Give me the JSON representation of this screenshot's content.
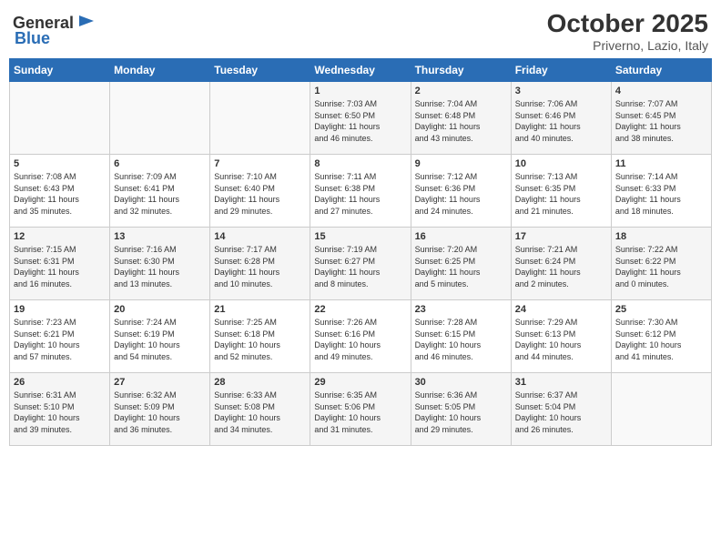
{
  "header": {
    "logo_general": "General",
    "logo_blue": "Blue",
    "month_title": "October 2025",
    "location": "Priverno, Lazio, Italy"
  },
  "weekdays": [
    "Sunday",
    "Monday",
    "Tuesday",
    "Wednesday",
    "Thursday",
    "Friday",
    "Saturday"
  ],
  "weeks": [
    [
      {
        "day": "",
        "info": ""
      },
      {
        "day": "",
        "info": ""
      },
      {
        "day": "",
        "info": ""
      },
      {
        "day": "1",
        "info": "Sunrise: 7:03 AM\nSunset: 6:50 PM\nDaylight: 11 hours\nand 46 minutes."
      },
      {
        "day": "2",
        "info": "Sunrise: 7:04 AM\nSunset: 6:48 PM\nDaylight: 11 hours\nand 43 minutes."
      },
      {
        "day": "3",
        "info": "Sunrise: 7:06 AM\nSunset: 6:46 PM\nDaylight: 11 hours\nand 40 minutes."
      },
      {
        "day": "4",
        "info": "Sunrise: 7:07 AM\nSunset: 6:45 PM\nDaylight: 11 hours\nand 38 minutes."
      }
    ],
    [
      {
        "day": "5",
        "info": "Sunrise: 7:08 AM\nSunset: 6:43 PM\nDaylight: 11 hours\nand 35 minutes."
      },
      {
        "day": "6",
        "info": "Sunrise: 7:09 AM\nSunset: 6:41 PM\nDaylight: 11 hours\nand 32 minutes."
      },
      {
        "day": "7",
        "info": "Sunrise: 7:10 AM\nSunset: 6:40 PM\nDaylight: 11 hours\nand 29 minutes."
      },
      {
        "day": "8",
        "info": "Sunrise: 7:11 AM\nSunset: 6:38 PM\nDaylight: 11 hours\nand 27 minutes."
      },
      {
        "day": "9",
        "info": "Sunrise: 7:12 AM\nSunset: 6:36 PM\nDaylight: 11 hours\nand 24 minutes."
      },
      {
        "day": "10",
        "info": "Sunrise: 7:13 AM\nSunset: 6:35 PM\nDaylight: 11 hours\nand 21 minutes."
      },
      {
        "day": "11",
        "info": "Sunrise: 7:14 AM\nSunset: 6:33 PM\nDaylight: 11 hours\nand 18 minutes."
      }
    ],
    [
      {
        "day": "12",
        "info": "Sunrise: 7:15 AM\nSunset: 6:31 PM\nDaylight: 11 hours\nand 16 minutes."
      },
      {
        "day": "13",
        "info": "Sunrise: 7:16 AM\nSunset: 6:30 PM\nDaylight: 11 hours\nand 13 minutes."
      },
      {
        "day": "14",
        "info": "Sunrise: 7:17 AM\nSunset: 6:28 PM\nDaylight: 11 hours\nand 10 minutes."
      },
      {
        "day": "15",
        "info": "Sunrise: 7:19 AM\nSunset: 6:27 PM\nDaylight: 11 hours\nand 8 minutes."
      },
      {
        "day": "16",
        "info": "Sunrise: 7:20 AM\nSunset: 6:25 PM\nDaylight: 11 hours\nand 5 minutes."
      },
      {
        "day": "17",
        "info": "Sunrise: 7:21 AM\nSunset: 6:24 PM\nDaylight: 11 hours\nand 2 minutes."
      },
      {
        "day": "18",
        "info": "Sunrise: 7:22 AM\nSunset: 6:22 PM\nDaylight: 11 hours\nand 0 minutes."
      }
    ],
    [
      {
        "day": "19",
        "info": "Sunrise: 7:23 AM\nSunset: 6:21 PM\nDaylight: 10 hours\nand 57 minutes."
      },
      {
        "day": "20",
        "info": "Sunrise: 7:24 AM\nSunset: 6:19 PM\nDaylight: 10 hours\nand 54 minutes."
      },
      {
        "day": "21",
        "info": "Sunrise: 7:25 AM\nSunset: 6:18 PM\nDaylight: 10 hours\nand 52 minutes."
      },
      {
        "day": "22",
        "info": "Sunrise: 7:26 AM\nSunset: 6:16 PM\nDaylight: 10 hours\nand 49 minutes."
      },
      {
        "day": "23",
        "info": "Sunrise: 7:28 AM\nSunset: 6:15 PM\nDaylight: 10 hours\nand 46 minutes."
      },
      {
        "day": "24",
        "info": "Sunrise: 7:29 AM\nSunset: 6:13 PM\nDaylight: 10 hours\nand 44 minutes."
      },
      {
        "day": "25",
        "info": "Sunrise: 7:30 AM\nSunset: 6:12 PM\nDaylight: 10 hours\nand 41 minutes."
      }
    ],
    [
      {
        "day": "26",
        "info": "Sunrise: 6:31 AM\nSunset: 5:10 PM\nDaylight: 10 hours\nand 39 minutes."
      },
      {
        "day": "27",
        "info": "Sunrise: 6:32 AM\nSunset: 5:09 PM\nDaylight: 10 hours\nand 36 minutes."
      },
      {
        "day": "28",
        "info": "Sunrise: 6:33 AM\nSunset: 5:08 PM\nDaylight: 10 hours\nand 34 minutes."
      },
      {
        "day": "29",
        "info": "Sunrise: 6:35 AM\nSunset: 5:06 PM\nDaylight: 10 hours\nand 31 minutes."
      },
      {
        "day": "30",
        "info": "Sunrise: 6:36 AM\nSunset: 5:05 PM\nDaylight: 10 hours\nand 29 minutes."
      },
      {
        "day": "31",
        "info": "Sunrise: 6:37 AM\nSunset: 5:04 PM\nDaylight: 10 hours\nand 26 minutes."
      },
      {
        "day": "",
        "info": ""
      }
    ]
  ]
}
